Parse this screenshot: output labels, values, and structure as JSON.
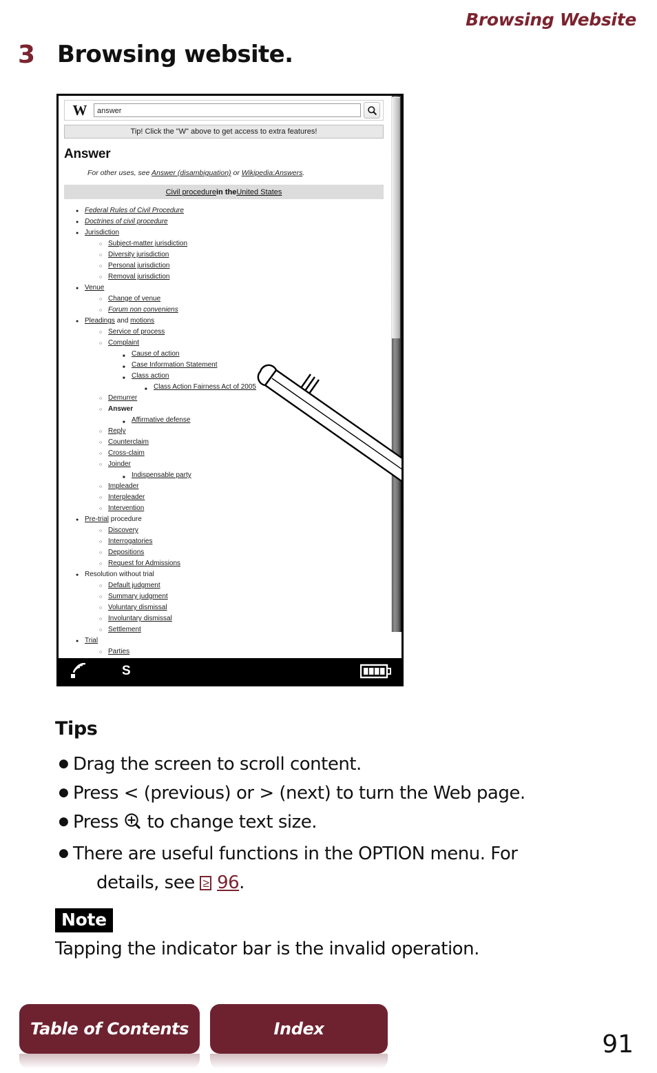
{
  "header": {
    "running_title": "Browsing Website"
  },
  "step": {
    "number": "3",
    "title": "Browsing website."
  },
  "device": {
    "browser": {
      "logo": "W",
      "search_value": "answer",
      "search_icon": "magnifier-icon",
      "search_button_label": "Search",
      "tip_bar": "Tip! Click the \"W\" above to get access to extra features!"
    },
    "article": {
      "title": "Answer",
      "disambiguation_prefix": "For other uses, see ",
      "disambiguation_link1": "Answer (disambiguation)",
      "disambiguation_or": " or ",
      "disambiguation_link2": "Wikipedia:Answers",
      "disambiguation_suffix": ".",
      "infobox_title_link1": "Civil procedure",
      "infobox_title_mid": " in the ",
      "infobox_title_link2": "United States"
    },
    "outline": [
      {
        "level": 1,
        "text": "Federal Rules of Civil Procedure",
        "style": "italic-link"
      },
      {
        "level": 1,
        "text": "Doctrines of civil procedure",
        "style": "italic-link"
      },
      {
        "level": 1,
        "text": "Jurisdiction",
        "style": "link"
      },
      {
        "level": 2,
        "text": "Subject-matter jurisdiction",
        "style": "link"
      },
      {
        "level": 2,
        "text": "Diversity jurisdiction",
        "style": "link"
      },
      {
        "level": 2,
        "text": "Personal jurisdiction",
        "style": "link"
      },
      {
        "level": 2,
        "text": "Removal jurisdiction",
        "style": "link"
      },
      {
        "level": 1,
        "text": "Venue",
        "style": "link"
      },
      {
        "level": 2,
        "text": "Change of venue",
        "style": "link"
      },
      {
        "level": 2,
        "text": "Forum non conveniens",
        "style": "italic-link"
      },
      {
        "level": 1,
        "text": "Pleadings and motions",
        "style": "split-link"
      },
      {
        "level": 2,
        "text": "Service of process",
        "style": "link"
      },
      {
        "level": 2,
        "text": "Complaint",
        "style": "link"
      },
      {
        "level": 3,
        "text": "Cause of action",
        "style": "link"
      },
      {
        "level": 3,
        "text": "Case Information Statement",
        "style": "link"
      },
      {
        "level": 3,
        "text": "Class action",
        "style": "link"
      },
      {
        "level": 4,
        "text": "Class Action Fairness Act of 2005",
        "style": "link"
      },
      {
        "level": 2,
        "text": "Demurrer",
        "style": "link"
      },
      {
        "level": 2,
        "text": "Answer",
        "style": "bold"
      },
      {
        "level": 3,
        "text": "Affirmative defense",
        "style": "link"
      },
      {
        "level": 2,
        "text": "Reply",
        "style": "link"
      },
      {
        "level": 2,
        "text": "Counterclaim",
        "style": "link"
      },
      {
        "level": 2,
        "text": "Cross-claim",
        "style": "link"
      },
      {
        "level": 2,
        "text": "Joinder",
        "style": "link"
      },
      {
        "level": 3,
        "text": "Indispensable party",
        "style": "link"
      },
      {
        "level": 2,
        "text": "Impleader",
        "style": "link"
      },
      {
        "level": 2,
        "text": "Interpleader",
        "style": "link"
      },
      {
        "level": 2,
        "text": "Intervention",
        "style": "link"
      },
      {
        "level": 1,
        "text": "Pre-trial procedure",
        "style": "split-link"
      },
      {
        "level": 2,
        "text": "Discovery",
        "style": "link"
      },
      {
        "level": 2,
        "text": "Interrogatories",
        "style": "link"
      },
      {
        "level": 2,
        "text": "Depositions",
        "style": "link"
      },
      {
        "level": 2,
        "text": "Request for Admissions",
        "style": "link"
      },
      {
        "level": 1,
        "text": "Resolution without trial",
        "style": "plain"
      },
      {
        "level": 2,
        "text": "Default judgment",
        "style": "link"
      },
      {
        "level": 2,
        "text": "Summary judgment",
        "style": "link"
      },
      {
        "level": 2,
        "text": "Voluntary dismissal",
        "style": "link"
      },
      {
        "level": 2,
        "text": "Involuntary dismissal",
        "style": "link"
      },
      {
        "level": 2,
        "text": "Settlement",
        "style": "link"
      },
      {
        "level": 1,
        "text": "Trial",
        "style": "link"
      },
      {
        "level": 2,
        "text": "Parties",
        "style": "link"
      }
    ],
    "indicator_bar": {
      "wifi_icon": "wifi-signal-icon",
      "storage_label": "S",
      "battery_icon": "battery-full-icon"
    },
    "stylus": "stylus-pen-illustration",
    "scrollbar": "vertical-scrollbar"
  },
  "tips": {
    "heading": "Tips",
    "items": [
      {
        "parts": [
          {
            "t": "text",
            "v": "Drag the screen to scroll content."
          }
        ]
      },
      {
        "parts": [
          {
            "t": "text",
            "v": "Press < (previous) or > (next) to turn the Web page."
          }
        ]
      },
      {
        "parts": [
          {
            "t": "text",
            "v": "Press "
          },
          {
            "t": "icon",
            "v": "zoom-in-icon"
          },
          {
            "t": "text",
            "v": " to change text size."
          }
        ]
      },
      {
        "parts": [
          {
            "t": "text",
            "v": "There are useful functions in the OPTION menu. For"
          },
          {
            "t": "break",
            "v": ""
          },
          {
            "t": "text",
            "v": "details, see "
          },
          {
            "t": "pgbox",
            "v": "≥"
          },
          {
            "t": "pgnum",
            "v": "96"
          },
          {
            "t": "text",
            "v": "."
          }
        ]
      }
    ]
  },
  "note": {
    "badge": "Note",
    "text": "Tapping the indicator bar is the invalid operation."
  },
  "footer": {
    "toc_label": "Table of Contents",
    "index_label": "Index",
    "page_number": "91"
  },
  "colors": {
    "accent_maroon": "#7B2430",
    "button_maroon": "#6E2230",
    "indicator_bar": "#000000"
  }
}
